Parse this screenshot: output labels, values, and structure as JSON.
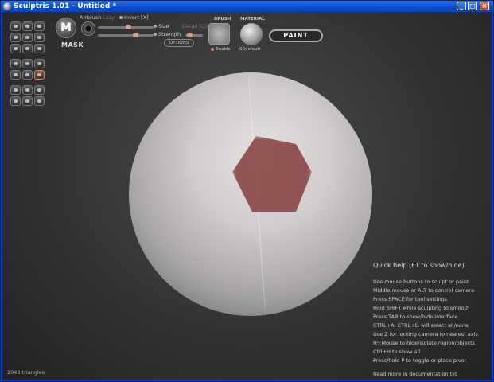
{
  "window": {
    "title": "Sculptris 1.01 - Untitled *"
  },
  "toolbar": {
    "mask_label": "MASK",
    "mask_letter": "M",
    "airbrush": "Airbrush",
    "lazy": "Lazy",
    "invert": "Invert [X]",
    "size": "Size",
    "strength": "Strength",
    "detail": "Detail [Q]",
    "options": "OPTIONS",
    "brush_header": "BRUSH",
    "enable": "Enable",
    "material_header": "MATERIAL",
    "material_name": "00default",
    "paint": "PAINT",
    "size_value": 0.55,
    "strength_value": 0.7
  },
  "help": {
    "title": "Quick help (F1 to show/hide)",
    "lines": [
      "Use mouse buttons to sculpt or paint",
      "Middle mouse or ALT to control camera",
      "Press SPACE for tool settings",
      "Hold SHIFT while sculpting to smooth",
      "Press TAB to show/hide interface",
      "CTRL+A, CTRL+D will select all/none",
      "Use Z for locking camera to nearest axis",
      "H+Mouse to hide/isolate region/objects",
      "Ctrl+H to show all",
      "Press/hold P to toggle or place pivot"
    ],
    "footer": "Read more in documentation.txt"
  },
  "status": {
    "triangles": "2048 triangles"
  },
  "icons": {
    "tools": [
      "crease-icon",
      "rotate-icon",
      "scale-icon",
      "draw-icon",
      "flatten-icon",
      "pinch-icon",
      "inflate-icon",
      "grab-icon",
      "smooth-icon",
      "symmetry-icon",
      "wireframe-icon",
      "grid-icon",
      "reduce-icon",
      "mirror-icon",
      "paint-mode-icon",
      "undo-icon",
      "redo-icon",
      "settings-icon",
      "save-icon",
      "open-icon",
      "new-icon"
    ]
  }
}
